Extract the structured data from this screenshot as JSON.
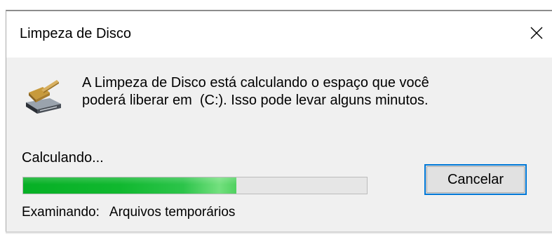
{
  "window": {
    "title": "Limpeza de Disco"
  },
  "icons": {
    "app": "disk-cleanup-broom-icon",
    "close": "close-icon"
  },
  "message": {
    "line1": "A Limpeza de Disco está calculando o espaço que você",
    "line2": "poderá liberar em  (C:). Isso pode levar alguns minutos."
  },
  "status": {
    "label": "Calculando...",
    "progress_percent": 62,
    "scanning_label": "Examinando:",
    "scanning_item": "Arquivos temporários"
  },
  "buttons": {
    "cancel_label": "Cancelar"
  },
  "colors": {
    "accent": "#0078d7",
    "progress": "#06b025",
    "body_background": "#f0f0f0"
  }
}
